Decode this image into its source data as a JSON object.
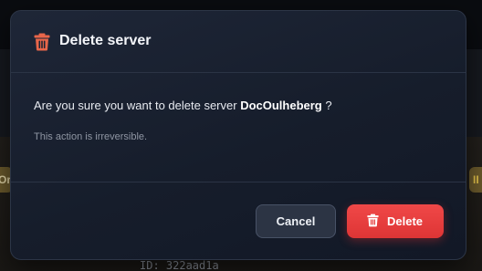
{
  "modal": {
    "title": "Delete server",
    "title_icon": "trash-icon",
    "question_prefix": "Are you sure you want to delete server ",
    "server_name": "DocOulheberg",
    "question_suffix": " ?",
    "warning": "This action is irreversible.",
    "cancel_label": "Cancel",
    "delete_label": "Delete",
    "delete_icon": "trash-icon"
  },
  "background": {
    "server_id": "ID: 322aad1a",
    "left_chip_text": "Or",
    "right_chip_text": "II"
  },
  "colors": {
    "danger": "#e53b3b",
    "icon_accent": "#e8664a",
    "modal_bg": "#1a2130",
    "cancel_bg": "#2c3444"
  }
}
